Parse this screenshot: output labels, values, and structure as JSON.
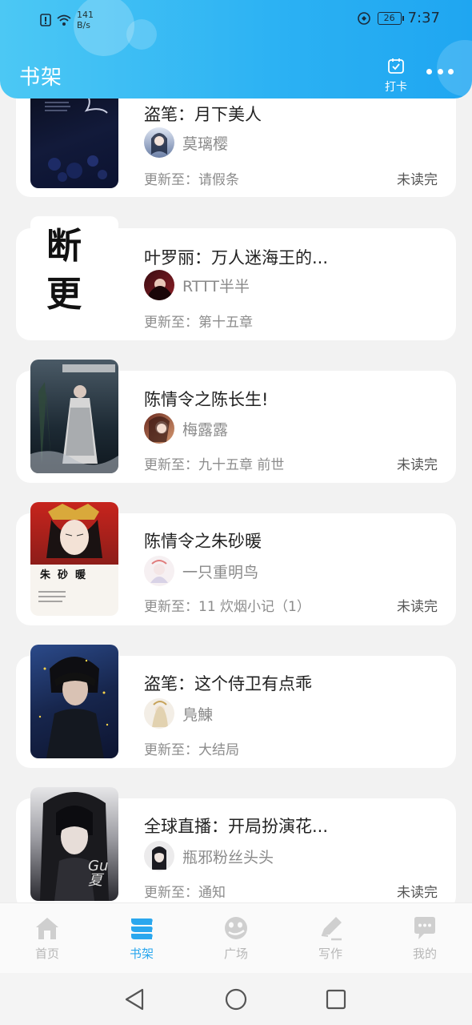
{
  "status_bar": {
    "net_speed_value": "141",
    "net_speed_unit": "B/s",
    "battery": "26",
    "time": "7:37"
  },
  "header": {
    "title": "书架",
    "checkin_label": "打卡"
  },
  "books": [
    {
      "title": "盗笔：月下美人",
      "author": "莫璃樱",
      "update": "更新至：请假条",
      "status": "未读完"
    },
    {
      "title": "叶罗丽：万人迷海王的...",
      "cover_text": [
        "断",
        "更"
      ],
      "author": "RTTT半半",
      "update": "更新至：第十五章",
      "status": ""
    },
    {
      "title": "陈情令之陈长生!",
      "author": "梅露露",
      "update": "更新至：九十五章  前世",
      "status": "未读完"
    },
    {
      "title": "陈情令之朱砂暖",
      "cover_text": [
        "朱",
        "砂",
        "暖"
      ],
      "author": "一只重明鸟",
      "update": "更新至：11 炊烟小记（1）",
      "status": "未读完"
    },
    {
      "title": "盗笔：这个侍卫有点乖",
      "author": "鳬鯟",
      "update": "更新至：大结局",
      "status": ""
    },
    {
      "title": "全球直播：开局扮演花...",
      "cover_text": [
        "Gu",
        "夏"
      ],
      "author": "瓶邪粉丝头头",
      "update": "更新至：通知",
      "status": "未读完"
    }
  ],
  "bottom_nav": [
    {
      "label": "首页",
      "icon": "home-icon",
      "active": false
    },
    {
      "label": "书架",
      "icon": "bookshelf-icon",
      "active": true
    },
    {
      "label": "广场",
      "icon": "plaza-icon",
      "active": false
    },
    {
      "label": "写作",
      "icon": "pencil-icon",
      "active": false
    },
    {
      "label": "我的",
      "icon": "chat-bubble-icon",
      "active": false
    }
  ],
  "colors": {
    "header_start": "#4cc8f4",
    "header_end": "#1fa6f1",
    "nav_active": "#2aa7ee",
    "nav_inactive": "#b7b7b7",
    "background": "#f2f2f2"
  }
}
